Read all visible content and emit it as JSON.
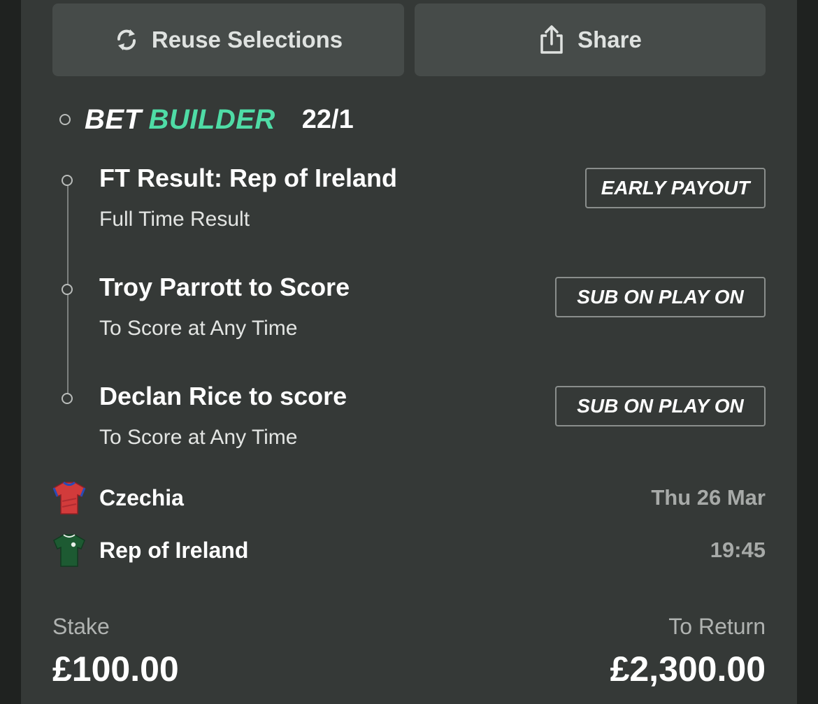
{
  "actions": {
    "reuse_label": "Reuse Selections",
    "share_label": "Share"
  },
  "bet": {
    "type_part1": "BET",
    "type_part2": "BUILDER",
    "odds": "22/1",
    "accent_color": "#4fdca6"
  },
  "legs": [
    {
      "title": "FT Result: Rep of Ireland",
      "market": "Full Time Result",
      "badge": "EARLY PAYOUT"
    },
    {
      "title": "Troy Parrott to Score",
      "market": "To Score at Any Time",
      "badge": "SUB ON PLAY ON"
    },
    {
      "title": "Declan Rice to score",
      "market": "To Score at Any Time",
      "badge": "SUB ON PLAY ON"
    }
  ],
  "match": {
    "home_team": "Czechia",
    "away_team": "Rep of Ireland",
    "date": "Thu 26 Mar",
    "time": "19:45",
    "home_icon": "red-shirt-icon",
    "away_icon": "green-shirt-icon"
  },
  "summary": {
    "stake_label": "Stake",
    "stake_value": "£100.00",
    "return_label": "To Return",
    "return_value": "£2,300.00"
  }
}
